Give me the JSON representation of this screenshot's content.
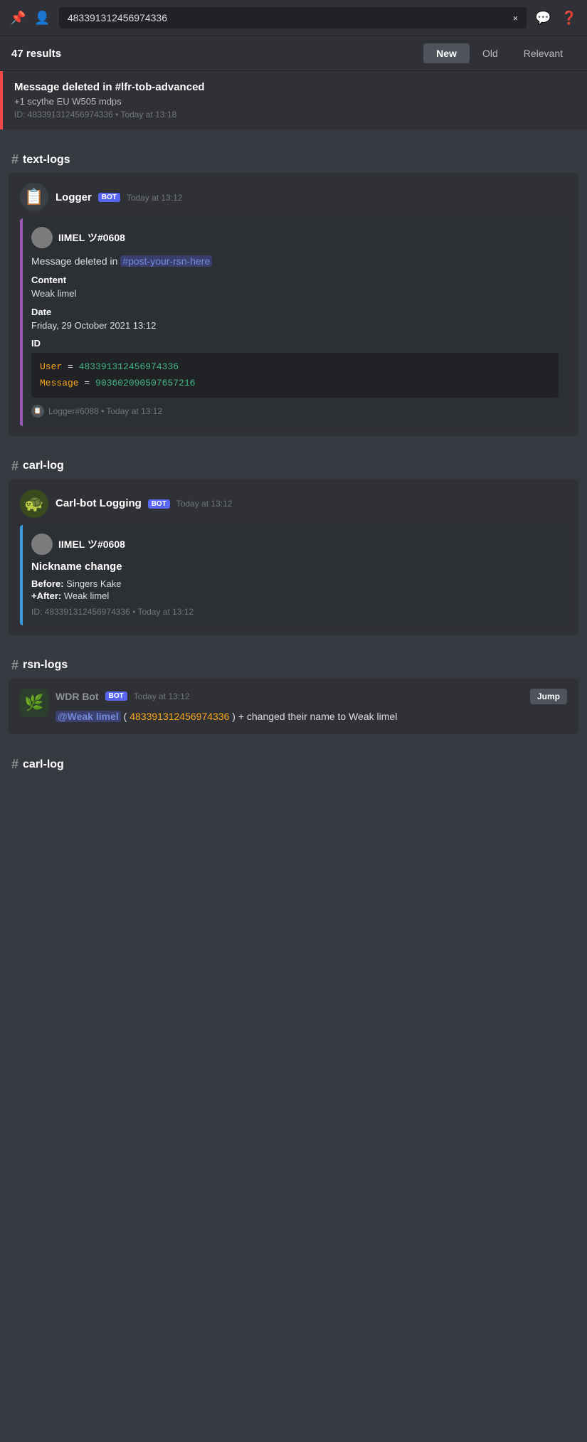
{
  "topbar": {
    "search_value": "483391312456974336",
    "clear_label": "×",
    "icon1": "📌",
    "icon2": "👤",
    "icon3": "💬",
    "icon4": "❓"
  },
  "results": {
    "count_label": "47 results",
    "tabs": [
      {
        "label": "New",
        "active": true
      },
      {
        "label": "Old",
        "active": false
      },
      {
        "label": "Relevant",
        "active": false
      }
    ]
  },
  "deleted_top": {
    "title": "Message deleted in #lfr-tob-advanced",
    "subtitle": "+1 scythe EU W505 mdps",
    "id_line": "ID: 483391312456974336 • Today at 13:18"
  },
  "sections": [
    {
      "id": "text-logs",
      "channel_name": "text-logs",
      "message": {
        "username": "Logger",
        "is_bot": true,
        "timestamp": "Today at 13:12",
        "avatar_type": "logger",
        "embed": {
          "border_color": "purple",
          "user": {
            "name": "IIMEL ツ#0608",
            "avatar_type": "user"
          },
          "description_pre": "Message deleted in",
          "channel_mention": "#post-your-rsn-here",
          "fields": [
            {
              "name": "Content",
              "value": "Weak limel"
            },
            {
              "name": "Date",
              "value": "Friday, 29 October 2021 13:12"
            },
            {
              "name": "ID",
              "value": ""
            }
          ],
          "id_block": {
            "user_key": "User",
            "user_val": "483391312456974336",
            "msg_key": "Message",
            "msg_val": "903602090507657216"
          },
          "footer": {
            "text": "Logger#6088 • Today at 13:12"
          }
        }
      }
    },
    {
      "id": "carl-log-1",
      "channel_name": "carl-log",
      "message": {
        "username": "Carl-bot Logging",
        "is_bot": true,
        "timestamp": "Today at 13:12",
        "avatar_type": "carlbot",
        "embed": {
          "border_color": "blue",
          "user": {
            "name": "IIMEL ツ#0608",
            "avatar_type": "user"
          },
          "embed_title": "Nickname change",
          "before_label": "Before:",
          "before_value": "Singers Kake",
          "after_label": "+After:",
          "after_value": "Weak limel",
          "id_line": "ID: 483391312456974336 • Today at 13:12"
        }
      }
    },
    {
      "id": "rsn-logs",
      "channel_name": "rsn-logs",
      "message": {
        "username": "WDR Bot",
        "username_color": "#8e9297",
        "is_bot": true,
        "timestamp": "Today at 13:12",
        "avatar_type": "wdr",
        "jump_label": "Jump",
        "mention": "@Weak limel",
        "mention_id": "483391312456974336",
        "text": "changed their name to Weak limel"
      }
    },
    {
      "id": "carl-log-2",
      "channel_name": "carl-log",
      "empty": true
    }
  ]
}
